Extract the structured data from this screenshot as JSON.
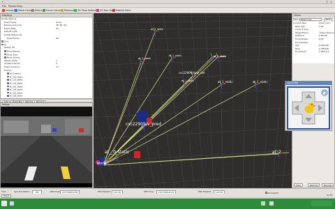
{
  "window": {
    "title": "* ...",
    "controls": [
      "_",
      "□",
      "×"
    ]
  },
  "menu": [
    "File",
    "Panels",
    "Help"
  ],
  "toolbar": [
    {
      "label": "Interact",
      "icon": "interact-icon",
      "color": "#c84a3c"
    },
    {
      "label": "Move Camera",
      "icon": "move-camera-icon",
      "color": "#3c7ac8"
    },
    {
      "label": "Select",
      "icon": "select-icon",
      "color": "#8a8a8a"
    },
    {
      "label": "Focus Camera",
      "icon": "focus-camera-icon",
      "color": "#4a9a4a"
    },
    {
      "label": "Measure",
      "icon": "measure-icon",
      "color": "#c8a83c"
    },
    {
      "label": "2D Pose Estimate",
      "icon": "pose-estimate-icon",
      "color": "#3cb04a"
    },
    {
      "label": "2D Nav Goal",
      "icon": "nav-goal-icon",
      "color": "#c83c8a"
    },
    {
      "label": "Publish Point",
      "icon": "publish-point-icon",
      "color": "#c83c3c"
    }
  ],
  "displays": {
    "title": "Displays",
    "rows": [
      {
        "label": "Global Options",
        "value": ""
      },
      {
        "label": "Fixed Frame",
        "value": "world"
      },
      {
        "label": "Background Color",
        "value": "48; 48; 48"
      },
      {
        "label": "Frame Rate",
        "value": "30"
      },
      {
        "label": "Default Light",
        "value": ""
      },
      {
        "label": "Global Status: Ok",
        "value": ""
      },
      {
        "label": "Fixed Frame",
        "value": "OK"
      },
      {
        "label": "Grid",
        "value": ""
      },
      {
        "label": "TF",
        "value": ""
      },
      {
        "label": "Status: Ok",
        "value": ""
      },
      {
        "label": "Show Names",
        "value": ""
      },
      {
        "label": "Show Axes",
        "value": ""
      },
      {
        "label": "Show Arrows",
        "value": ""
      },
      {
        "label": "Marker Scale",
        "value": "1"
      },
      {
        "label": "Update Interval",
        "value": "0"
      },
      {
        "label": "Frame Timeout",
        "value": "15"
      },
      {
        "label": "Frames",
        "value": ""
      },
      {
        "label": "All Enabled",
        "value": ""
      },
      {
        "label": "at_100_static",
        "value": ""
      },
      {
        "label": "at_101_static",
        "value": ""
      },
      {
        "label": "at_102_static",
        "value": ""
      },
      {
        "label": "at_103_static",
        "value": ""
      },
      {
        "label": "at_104_static",
        "value": ""
      },
      {
        "label": "at_105_static",
        "value": ""
      },
      {
        "label": "at_106_static",
        "value": ""
      }
    ],
    "buttons": [
      "Add",
      "Duplicate",
      "Remove",
      "Rename"
    ]
  },
  "image_panel": {
    "title": "Image"
  },
  "views": {
    "title": "Views",
    "type_label": "Type:",
    "type_value": "Orbit (rviz)",
    "zero": "Zero",
    "rows": [
      {
        "label": "Current View",
        "value": "Orbit (rviz)"
      },
      {
        "label": "Near Clip...",
        "value": "0.01"
      },
      {
        "label": "Invert Z Axis",
        "value": ""
      },
      {
        "label": "Target Frame",
        "value": "<Fixed Frame>"
      },
      {
        "label": "Distance",
        "value": "2.55132"
      },
      {
        "label": "Focal Shape...",
        "value": "0.05"
      },
      {
        "label": "Focal Shape...",
        "value": ""
      },
      {
        "label": "Yaw",
        "value": "0.935398"
      },
      {
        "label": "Pitch",
        "value": "0.785398"
      },
      {
        "label": "Focal Point",
        "value": "0.46;0.0;0"
      }
    ],
    "buttons": [
      "Save",
      "Remove",
      "Rename"
    ]
  },
  "teleop": {
    "title": "csc22909"
  },
  "scene_labels": [
    "at_1_static",
    "at_1_static",
    "at_1_static",
    "at_1_static",
    "at_1_static",
    "csc22909/lane_det",
    "at_1_static",
    "at_1_static",
    "at_1_static",
    "csc22909/v_pred",
    "at__0_static",
    "world",
    "at_2"
  ],
  "timebar": {
    "title": "Time",
    "ros_time_label": "ROS Time:",
    "ros_time": "1677938242.60",
    "ros_elapsed_label": "ROS Elapsed:",
    "ros_elapsed": "112.58",
    "wall_time_label": "Wall Time:",
    "wall_time": "1677938242.62",
    "wall_elapsed_label": "Wall Elapsed:",
    "wall_elapsed": "112.58",
    "experimental": "Experimental",
    "sync_label": "Synchronization:",
    "sync_value": "Off"
  },
  "reset_label": "Reset",
  "fps": "31 fps",
  "colors": {
    "grid": "#4a4946",
    "tf_line": "#d7e08a",
    "taskbar": "#2e8b3a",
    "background": "#303030"
  }
}
